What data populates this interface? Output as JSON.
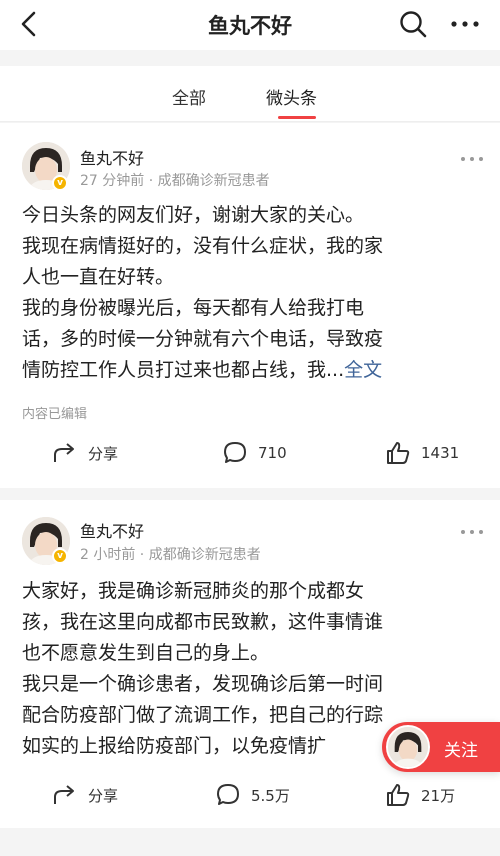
{
  "header": {
    "title": "鱼丸不好"
  },
  "tabs": [
    {
      "label": "全部"
    },
    {
      "label": "微头条"
    }
  ],
  "posts": [
    {
      "author": "鱼丸不好",
      "meta": "27 分钟前 · 成都确诊新冠患者",
      "lines": [
        "今日头条的网友们好，谢谢大家的关心。",
        "我现在病情挺好的，没有什么症状，我的家",
        "人也一直在好转。",
        "我的身份被曝光后，每天都有人给我打电",
        "话，多的时候一分钟就有六个电话，导致疫",
        "情防控工作人员打过来也都占线，我..."
      ],
      "full_text_link": "全文",
      "edited_note": "内容已编辑",
      "share_label": "分享",
      "comment_count": "710",
      "like_count": "1431"
    },
    {
      "author": "鱼丸不好",
      "meta": "2 小时前 · 成都确诊新冠患者",
      "lines": [
        "大家好，我是确诊新冠肺炎的那个成都女",
        "孩，我在这里向成都市民致歉，这件事情谁",
        "也不愿意发生到自己的身上。",
        "我只是一个确诊患者，发现确诊后第一时间",
        "配合防疫部门做了流调工作，把自己的行踪",
        "如实的上报给防疫部门，以免疫情扩"
      ],
      "share_label": "分享",
      "comment_count": "5.5万",
      "like_count": "21万"
    }
  ],
  "follow_button": {
    "label": "关注"
  },
  "colors": {
    "accent": "#f04142",
    "link": "#406599",
    "badge": "#f5b400"
  }
}
